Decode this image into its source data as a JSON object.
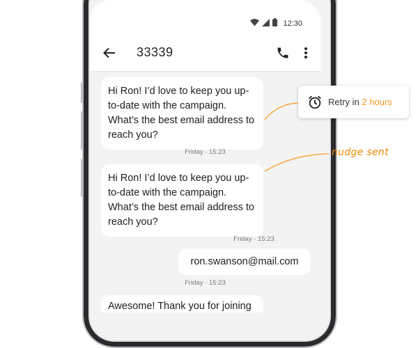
{
  "status_bar": {
    "time": "12:30"
  },
  "app_bar": {
    "title": "33339"
  },
  "messages": [
    {
      "type": "incoming",
      "text": "Hi Ron! I’d love to keep you up-to-date with the campaign. What’s the best email address to reach you?"
    },
    {
      "type": "timestamp",
      "text": "Friday · 15:23"
    },
    {
      "type": "incoming",
      "text": "Hi Ron! I’d love to keep you up-to-date with the campaign. What’s the best email address to reach you?"
    },
    {
      "type": "timestamp",
      "text": "Friday · 15:23"
    },
    {
      "type": "outgoing",
      "text": "ron.swanson@mail.com"
    },
    {
      "type": "timestamp",
      "text": "Friday · 15:23"
    },
    {
      "type": "incoming",
      "text": "Awesome! Thank you for joining"
    }
  ],
  "annotations": {
    "retry_prefix": "Retry in",
    "retry_value": "2 hours",
    "nudge_label": "nudge sent"
  },
  "colors": {
    "accent": "#f49a1c",
    "nudge": "#f08a00",
    "screen_bg": "#f3f3f3",
    "bubble_bg": "#ffffff"
  },
  "icons": {
    "back": "arrow-back-icon",
    "call": "phone-icon",
    "more": "more-vert-icon",
    "alarm": "alarm-clock-icon"
  }
}
